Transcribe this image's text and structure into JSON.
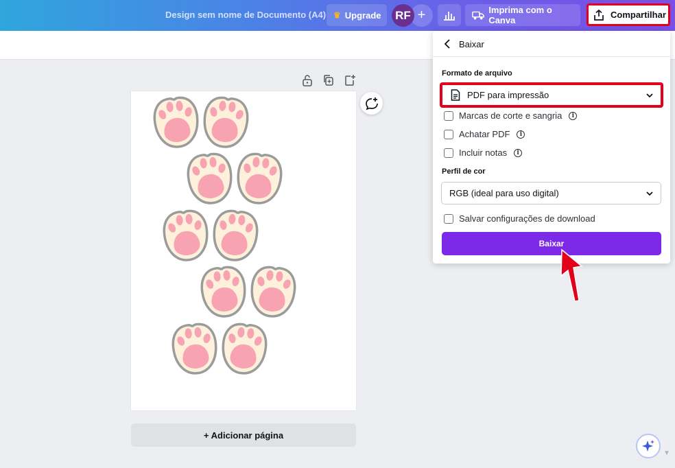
{
  "topbar": {
    "doc_title": "Design sem nome de Documento (A4)",
    "upgrade_label": "Upgrade",
    "avatar_initials": "RF",
    "add_label": "+",
    "print_label": "Imprima com o Canva",
    "share_label": "Compartilhar",
    "gradient_start": "#2fa6dc",
    "gradient_end": "#7a4fe8"
  },
  "canvas": {
    "add_page_label": "+ Adicionar página",
    "page_tool_icons": [
      "lock-icon",
      "duplicate-icon",
      "add-page-icon"
    ],
    "paw_rows": [
      2,
      2,
      2,
      2,
      2
    ]
  },
  "download_panel": {
    "title": "Baixar",
    "file_format_label": "Formato de arquivo",
    "file_format_value": "PDF para impressão",
    "options": [
      {
        "label": "Marcas de corte e sangria",
        "info": true,
        "checked": false
      },
      {
        "label": "Achatar PDF",
        "info": true,
        "checked": false
      },
      {
        "label": "Incluir notas",
        "info": true,
        "checked": false
      }
    ],
    "color_profile_label": "Perfil de cor",
    "color_profile_value": "RGB (ideal para uso digital)",
    "save_settings_label": "Salvar configurações de download",
    "download_button_label": "Baixar",
    "accent": "#7d2ae8",
    "highlight_color": "#e3001b"
  }
}
